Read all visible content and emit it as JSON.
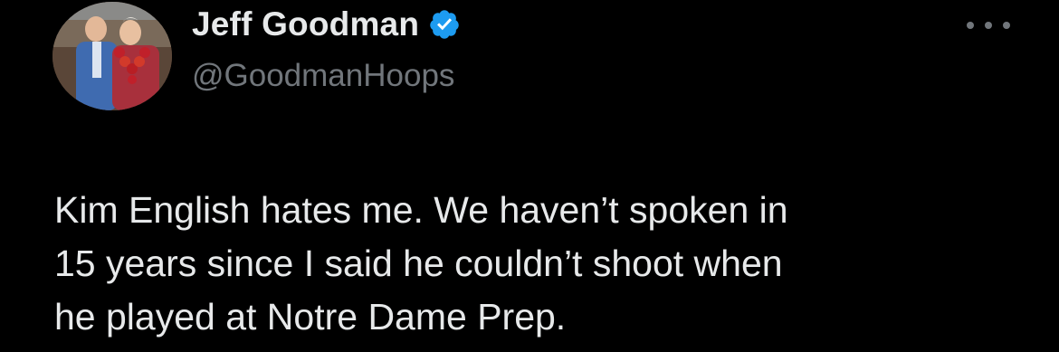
{
  "author": {
    "display_name": "Jeff Goodman",
    "handle": "@GoodmanHoops",
    "verified": true,
    "avatar_icon": "profile-photo"
  },
  "menu": {
    "icon": "more-horizontal-icon"
  },
  "tweet": {
    "lines": [
      "Kim English hates me. We haven’t spoken in",
      "15 years since I said he couldn’t shoot when",
      "he played at Notre Dame Prep."
    ]
  },
  "colors": {
    "background": "#000000",
    "text_primary": "#e7e9ea",
    "text_secondary": "#71767b",
    "verified_badge": "#1d9bf0"
  }
}
